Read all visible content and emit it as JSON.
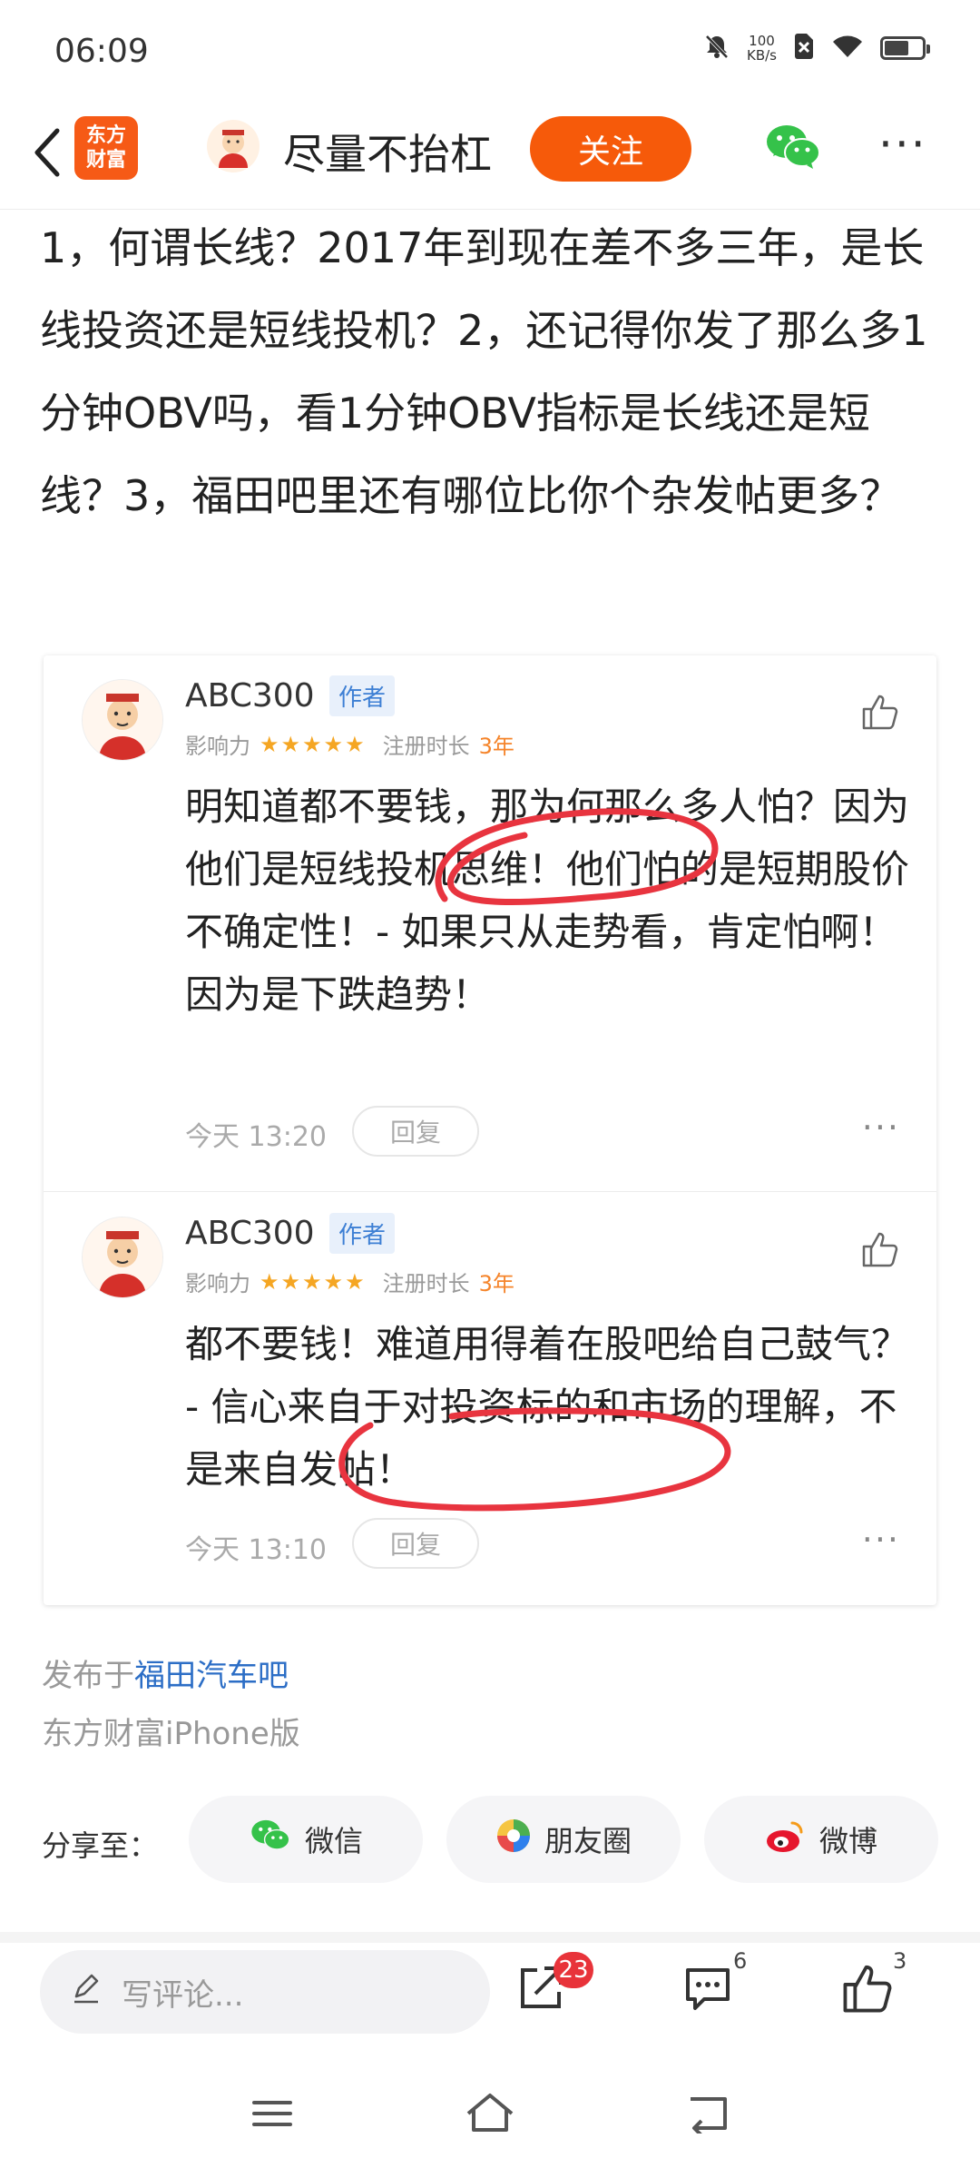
{
  "status_bar": {
    "time": "06:09",
    "net_speed_value": "100",
    "net_speed_unit": "KB/s",
    "icons": [
      "mute-bell-icon",
      "sim-off-icon",
      "wifi-icon",
      "battery-icon"
    ]
  },
  "header": {
    "app_logo_line1": "东方",
    "app_logo_line2": "财富",
    "username": "尽量不抬杠",
    "follow_label": "关注",
    "icons": [
      "back-arrow-icon",
      "wechat-icon",
      "more-icon"
    ]
  },
  "post": {
    "text": "1，何谓长线？2017年到现在差不多三年，是长线投资还是短线投机？2，还记得你发了那么多1分钟OBV吗，看1分钟OBV指标是长线还是短线？3，福田吧里还有哪位比你个杂发帖更多？"
  },
  "quoted_comments": [
    {
      "name": "ABC300",
      "author_tag": "作者",
      "influence_label": "影响力",
      "stars": "★★★★★",
      "reg_label": "注册时长",
      "reg_value": "3年",
      "text": "明知道都不要钱，那为何那么多人怕？因为他们是短线投机思维！他们怕的是短期股价不确定性！- 如果只从走势看，肯定怕啊！因为是下跌趋势！",
      "time": "今天 13:20",
      "reply_label": "回复"
    },
    {
      "name": "ABC300",
      "author_tag": "作者",
      "influence_label": "影响力",
      "stars": "★★★★★",
      "reg_label": "注册时长",
      "reg_value": "3年",
      "text": "都不要钱！难道用得着在股吧给自己鼓气？ - 信心来自于对投资标的和市场的理解，不是来自发帖！",
      "time": "今天 13:10",
      "reply_label": "回复"
    }
  ],
  "publish": {
    "prefix": "发布于",
    "board": "福田汽车吧",
    "client": "东方财富iPhone版"
  },
  "share": {
    "label": "分享至：",
    "targets": [
      {
        "label": "微信",
        "icon": "wechat-icon"
      },
      {
        "label": "朋友圈",
        "icon": "moments-icon"
      },
      {
        "label": "微博",
        "icon": "weibo-icon"
      }
    ]
  },
  "bottom_bar": {
    "comment_placeholder": "写评论...",
    "forward_count": "23",
    "comment_count": "6",
    "like_count": "3"
  },
  "colors": {
    "accent": "#f65a0a",
    "link": "#2c6ec6",
    "badge": "#e8333a",
    "highlight_circle": "#e8343f"
  }
}
